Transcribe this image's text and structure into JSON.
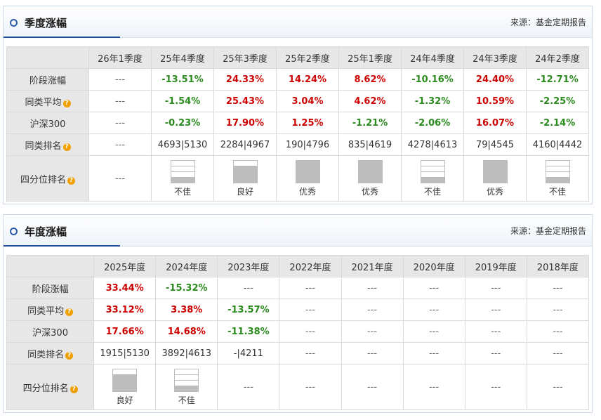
{
  "quarterly": {
    "title": "季度涨幅",
    "source": "来源：基金定期报告",
    "columns": [
      "26年1季度",
      "25年4季度",
      "25年3季度",
      "25年2季度",
      "25年1季度",
      "24年4季度",
      "24年3季度",
      "24年2季度"
    ],
    "rows": [
      {
        "label": "阶段涨幅",
        "help": false,
        "cells": [
          {
            "t": "---",
            "c": "dash"
          },
          {
            "t": "-13.51%",
            "c": "green"
          },
          {
            "t": "24.33%",
            "c": "red"
          },
          {
            "t": "14.24%",
            "c": "red"
          },
          {
            "t": "8.62%",
            "c": "red"
          },
          {
            "t": "-10.16%",
            "c": "green"
          },
          {
            "t": "24.40%",
            "c": "red"
          },
          {
            "t": "-12.71%",
            "c": "green"
          }
        ]
      },
      {
        "label": "同类平均",
        "help": true,
        "cells": [
          {
            "t": "---",
            "c": "dash"
          },
          {
            "t": "-1.54%",
            "c": "green"
          },
          {
            "t": "25.43%",
            "c": "red"
          },
          {
            "t": "3.04%",
            "c": "red"
          },
          {
            "t": "4.62%",
            "c": "red"
          },
          {
            "t": "-1.32%",
            "c": "green"
          },
          {
            "t": "10.59%",
            "c": "red"
          },
          {
            "t": "-2.25%",
            "c": "green"
          }
        ]
      },
      {
        "label": "沪深300",
        "help": false,
        "cells": [
          {
            "t": "---",
            "c": "dash"
          },
          {
            "t": "-0.23%",
            "c": "green"
          },
          {
            "t": "17.90%",
            "c": "red"
          },
          {
            "t": "1.25%",
            "c": "red"
          },
          {
            "t": "-1.21%",
            "c": "green"
          },
          {
            "t": "-2.06%",
            "c": "green"
          },
          {
            "t": "16.07%",
            "c": "red"
          },
          {
            "t": "-2.14%",
            "c": "green"
          }
        ]
      },
      {
        "label": "同类排名",
        "help": true,
        "cells": [
          {
            "t": "---",
            "c": "dash"
          },
          {
            "t": "4693|5130",
            "c": ""
          },
          {
            "t": "2284|4967",
            "c": ""
          },
          {
            "t": "190|4796",
            "c": ""
          },
          {
            "t": "835|4619",
            "c": ""
          },
          {
            "t": "4278|4613",
            "c": ""
          },
          {
            "t": "79|4545",
            "c": ""
          },
          {
            "t": "4160|4442",
            "c": ""
          }
        ]
      }
    ],
    "quartile": {
      "label": "四分位排名",
      "help": true,
      "cells": [
        {
          "dash": "---"
        },
        {
          "level": 4,
          "text": "不佳"
        },
        {
          "level": 2,
          "text": "良好"
        },
        {
          "level": 1,
          "text": "优秀"
        },
        {
          "level": 1,
          "text": "优秀"
        },
        {
          "level": 4,
          "text": "不佳"
        },
        {
          "level": 1,
          "text": "优秀"
        },
        {
          "level": 4,
          "text": "不佳"
        }
      ]
    }
  },
  "annual": {
    "title": "年度涨幅",
    "source": "来源：基金定期报告",
    "columns": [
      "2025年度",
      "2024年度",
      "2023年度",
      "2022年度",
      "2021年度",
      "2020年度",
      "2019年度",
      "2018年度"
    ],
    "rows": [
      {
        "label": "阶段涨幅",
        "help": false,
        "cells": [
          {
            "t": "33.44%",
            "c": "red"
          },
          {
            "t": "-15.32%",
            "c": "green"
          },
          {
            "t": "---",
            "c": "dash"
          },
          {
            "t": "---",
            "c": "dash"
          },
          {
            "t": "---",
            "c": "dash"
          },
          {
            "t": "---",
            "c": "dash"
          },
          {
            "t": "---",
            "c": "dash"
          },
          {
            "t": "---",
            "c": "dash"
          }
        ]
      },
      {
        "label": "同类平均",
        "help": true,
        "cells": [
          {
            "t": "33.12%",
            "c": "red"
          },
          {
            "t": "3.38%",
            "c": "red"
          },
          {
            "t": "-13.57%",
            "c": "green"
          },
          {
            "t": "---",
            "c": "dash"
          },
          {
            "t": "---",
            "c": "dash"
          },
          {
            "t": "---",
            "c": "dash"
          },
          {
            "t": "---",
            "c": "dash"
          },
          {
            "t": "---",
            "c": "dash"
          }
        ]
      },
      {
        "label": "沪深300",
        "help": false,
        "cells": [
          {
            "t": "17.66%",
            "c": "red"
          },
          {
            "t": "14.68%",
            "c": "red"
          },
          {
            "t": "-11.38%",
            "c": "green"
          },
          {
            "t": "---",
            "c": "dash"
          },
          {
            "t": "---",
            "c": "dash"
          },
          {
            "t": "---",
            "c": "dash"
          },
          {
            "t": "---",
            "c": "dash"
          },
          {
            "t": "---",
            "c": "dash"
          }
        ]
      },
      {
        "label": "同类排名",
        "help": true,
        "cells": [
          {
            "t": "1915|5130",
            "c": ""
          },
          {
            "t": "3892|4613",
            "c": ""
          },
          {
            "t": "-|4211",
            "c": ""
          },
          {
            "t": "---",
            "c": "dash"
          },
          {
            "t": "---",
            "c": "dash"
          },
          {
            "t": "---",
            "c": "dash"
          },
          {
            "t": "---",
            "c": "dash"
          },
          {
            "t": "---",
            "c": "dash"
          }
        ]
      }
    ],
    "quartile": {
      "label": "四分位排名",
      "help": true,
      "cells": [
        {
          "level": 2,
          "text": "良好"
        },
        {
          "level": 4,
          "text": "不佳"
        },
        {
          "dash": "---"
        },
        {
          "dash": "---"
        },
        {
          "dash": "---"
        },
        {
          "dash": "---"
        },
        {
          "dash": "---"
        },
        {
          "dash": "---"
        }
      ]
    }
  },
  "colors": {
    "positive": "#cc0000",
    "negative": "#2a8a1d",
    "header_bg": "#e7e7e7",
    "help_icon": "#f0a000",
    "accent": "#1f4f9c"
  },
  "icons": {
    "section": "ring-icon",
    "help": "question-icon",
    "quartile": "quartile-bar-icon"
  }
}
